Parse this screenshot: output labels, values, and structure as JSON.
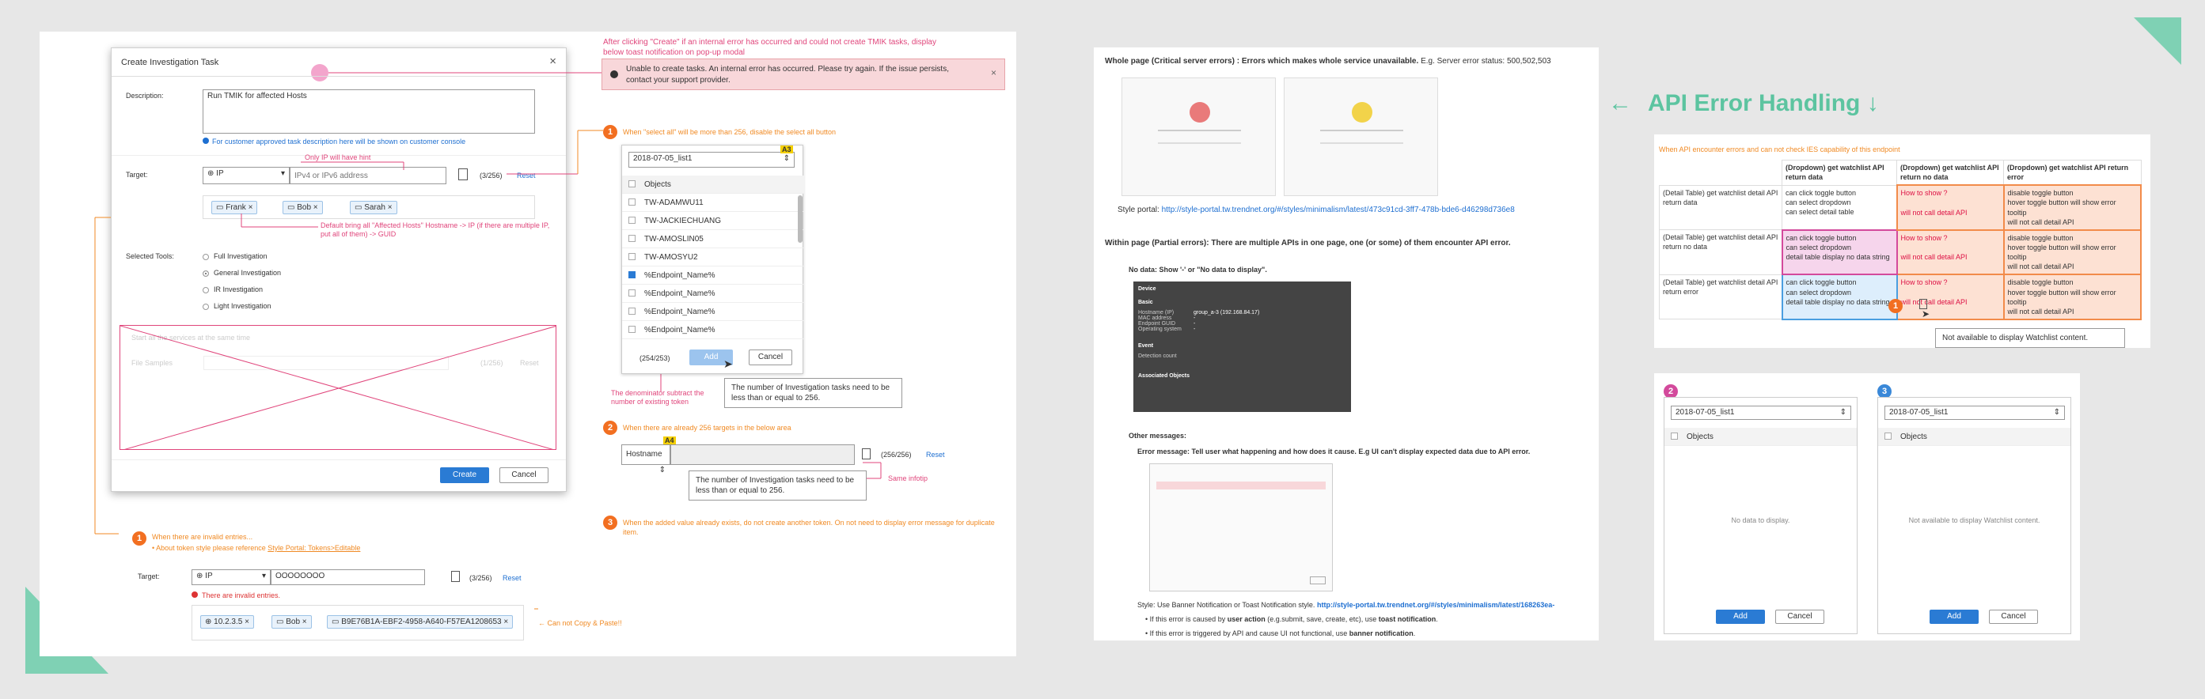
{
  "left": {
    "annotation_top": "After clicking \"Create\" if an internal error has occurred and could not create TMIK tasks, display below toast notification on pop-up modal",
    "toast_text": "Unable to create tasks. An internal error has occurred. Please try again. If the issue persists, contact your support provider.",
    "modal": {
      "title": "Create Investigation Task",
      "description_label": "Description:",
      "description_value": "Run TMIK for affected Hosts",
      "description_note": "For customer approved task description here will be shown on customer console",
      "target_label": "Target:",
      "target_type": "IP",
      "target_placeholder": "IPv4 or IPv6 address",
      "count": "(3/256)",
      "reset": "Reset",
      "chips": [
        "Frank",
        "Bob",
        "Sarah"
      ],
      "tools_label": "Selected Tools:",
      "tools": [
        "Full Investigation",
        "General Investigation",
        "IR Investigation",
        "Light Investigation"
      ],
      "faded_check": "Start all the services at the same time",
      "faded_label": "File Samples",
      "faded_count": "(1/256)",
      "faded_reset": "Reset",
      "create_label": "Create",
      "cancel_label": "Cancel"
    },
    "hint_only_ip": "Only IP will have hint",
    "hint_default": "Default bring all \"Affected Hosts\" Hostname -> IP (if there are multiple IP, put all of them) -> GUID",
    "note1": {
      "num": "1",
      "title": "When \"select all\" will be more than 256, disable the select all button",
      "dropdown": "2018-07-05_list1",
      "header": "Objects",
      "items": [
        "TW-ADAMWU11",
        "TW-JACKIECHUANG",
        "TW-AMOSLIN05",
        "TW-AMOSYU2",
        "%Endpoint_Name%",
        "%Endpoint_Name%",
        "%Endpoint_Name%",
        "%Endpoint_Name%",
        "%Endpoint_Name%"
      ],
      "count": "(254/253)",
      "add": "Add",
      "cancel": "Cancel",
      "tag": "A3",
      "tooltip": "The number of Investigation tasks need to be less than or equal to 256.",
      "denominator_note": "The denominator subtract the number of existing token"
    },
    "note2": {
      "num": "2",
      "title": "When there are already 256 targets in the below area",
      "select": "Hostname",
      "tag": "A4",
      "count": "(256/256)",
      "reset": "Reset",
      "tooltip": "The number of Investigation tasks need to be less than or equal to 256.",
      "same_infotip": "Same infotip"
    },
    "note3": {
      "num": "3",
      "text": "When the added value already exists, do not create another token.  On not need to display error message for duplicate item."
    },
    "note4": {
      "num": "1",
      "line1": "When there are invalid entries...",
      "line2_prefix": "• About token style please reference ",
      "line2_link": "Style Portal: Tokens>Editable"
    },
    "bottom": {
      "target_label": "Target:",
      "type": "IP",
      "value": "OOOOOOOO",
      "count": "(3/256)",
      "reset": "Reset",
      "error": "There are invalid entries.",
      "chips": [
        "10.2.3.5",
        "Bob",
        "B9E76B1A-EBF2-4958-A640-F57EA1208653"
      ],
      "copy_note": "Can not Copy & Paste!!"
    }
  },
  "right": {
    "heading": "API Error Handling",
    "item1_title": "Whole page (Critical server errors) : Errors which makes whole service unavailable.",
    "item1_eg": "E.g. Server error status: 500,502,503",
    "style_portal_label": "Style portal:",
    "style_portal_url": "http://style-portal.tw.trendnet.org/#/styles/minimalism/latest/473c91cd-3ff7-478b-bde6-d46298d736e8",
    "item2_title": "Within page (Partial errors): There are multiple APIs in one page, one (or some) of them encounter API error.",
    "item2a": "No data: Show '-' or \"No data to display\".",
    "device": {
      "title": "Device",
      "basic": "Basic",
      "fields": [
        [
          "Hostname (IP)",
          "group_a-3 (192.168.84.17)"
        ],
        [
          "MAC address",
          "-"
        ],
        [
          "Endpoint GUID",
          "-"
        ],
        [
          "Operating system",
          "-"
        ]
      ],
      "event": "Event",
      "detection": "Detection count",
      "associated": "Associated Objects"
    },
    "item2b": "Other messages:",
    "item2b_detail": "Error message: Tell user what happening and how does it cause. E.g  UI can't display expected data due to API error.",
    "style_line_prefix": "Style: Use Banner Notification or Toast Notification style.",
    "style_line_url": "http://style-portal.tw.trendnet.org/#/styles/minimalism/latest/168263ea-",
    "bullet1_prefix": "If this error is caused by ",
    "bullet1_bold": "user action",
    "bullet1_mid": " (e.g.submit, save, create, etc), use ",
    "bullet1_bold2": "toast notification",
    "bullet2_prefix": "If this error is triggered by API and cause UI not functional, use ",
    "bullet2_bold": "banner notification",
    "table_note": "When API encounter errors and can not check IES capability of this endpoint",
    "table": {
      "headers": [
        "",
        "(Dropdown) get watchlist API return data",
        "(Dropdown) get watchlist API return no data",
        "(Dropdown) get watchlist API return error"
      ],
      "rows": [
        [
          "(Detail Table) get watchlist detail API return data",
          "can click toggle button\ncan select dropdown\ncan select detail table",
          "How to show ?\n\nwill not call detail API",
          "disable toggle button\nhover toggle button will show error tooltip\nwill not call detail API"
        ],
        [
          "(Detail Table) get watchlist detail API return no data",
          "can click toggle button\ncan select dropdown\ndetail table display no data string",
          "How to show ?\n\nwill not call detail API",
          "disable toggle button\nhover toggle button will show error tooltip\nwill not call detail API"
        ],
        [
          "(Detail Table) get watchlist detail API return error",
          "can click toggle button\ncan select dropdown\ndetail table display no data string",
          "How to show ?\n\nwill not call detail API",
          "disable toggle button\nhover toggle button will show error tooltip\nwill not call detail API"
        ]
      ]
    },
    "tooltip_watchlist": "Not available to display Watchlist content.",
    "panel2": {
      "num": "2",
      "dropdown": "2018-07-05_list1",
      "header": "Objects",
      "empty": "No data to display.",
      "add": "Add",
      "cancel": "Cancel"
    },
    "panel3": {
      "num": "3",
      "dropdown": "2018-07-05_list1",
      "header": "Objects",
      "empty": "Not available to display Watchlist content.",
      "add": "Add",
      "cancel": "Cancel"
    },
    "num1": "1"
  },
  "colors": {
    "orange": "#f26f21",
    "pink": "#e0457b",
    "teal": "#5cc4a0",
    "blue": "#2a7bd4"
  }
}
